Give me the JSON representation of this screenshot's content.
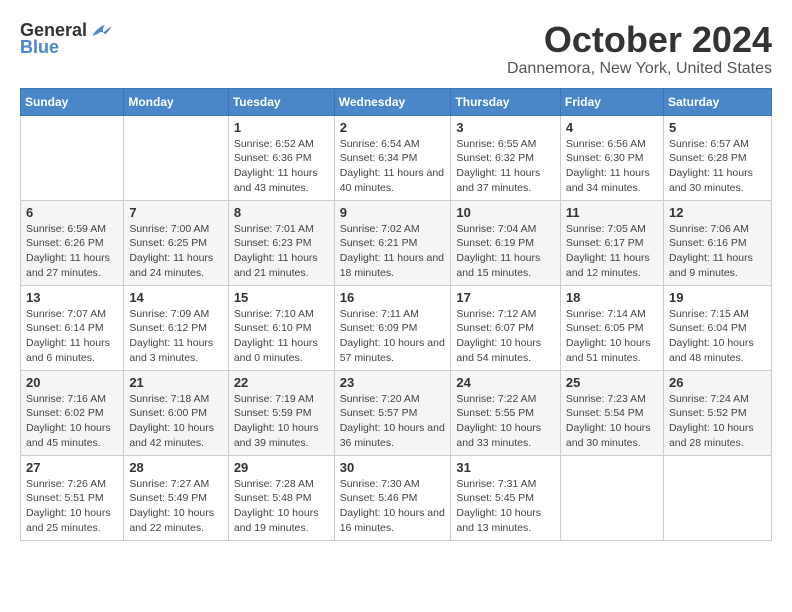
{
  "logo": {
    "general": "General",
    "blue": "Blue"
  },
  "title": "October 2024",
  "location": "Dannemora, New York, United States",
  "days_of_week": [
    "Sunday",
    "Monday",
    "Tuesday",
    "Wednesday",
    "Thursday",
    "Friday",
    "Saturday"
  ],
  "weeks": [
    [
      {
        "day": "",
        "info": ""
      },
      {
        "day": "",
        "info": ""
      },
      {
        "day": "1",
        "info": "Sunrise: 6:52 AM\nSunset: 6:36 PM\nDaylight: 11 hours and 43 minutes."
      },
      {
        "day": "2",
        "info": "Sunrise: 6:54 AM\nSunset: 6:34 PM\nDaylight: 11 hours and 40 minutes."
      },
      {
        "day": "3",
        "info": "Sunrise: 6:55 AM\nSunset: 6:32 PM\nDaylight: 11 hours and 37 minutes."
      },
      {
        "day": "4",
        "info": "Sunrise: 6:56 AM\nSunset: 6:30 PM\nDaylight: 11 hours and 34 minutes."
      },
      {
        "day": "5",
        "info": "Sunrise: 6:57 AM\nSunset: 6:28 PM\nDaylight: 11 hours and 30 minutes."
      }
    ],
    [
      {
        "day": "6",
        "info": "Sunrise: 6:59 AM\nSunset: 6:26 PM\nDaylight: 11 hours and 27 minutes."
      },
      {
        "day": "7",
        "info": "Sunrise: 7:00 AM\nSunset: 6:25 PM\nDaylight: 11 hours and 24 minutes."
      },
      {
        "day": "8",
        "info": "Sunrise: 7:01 AM\nSunset: 6:23 PM\nDaylight: 11 hours and 21 minutes."
      },
      {
        "day": "9",
        "info": "Sunrise: 7:02 AM\nSunset: 6:21 PM\nDaylight: 11 hours and 18 minutes."
      },
      {
        "day": "10",
        "info": "Sunrise: 7:04 AM\nSunset: 6:19 PM\nDaylight: 11 hours and 15 minutes."
      },
      {
        "day": "11",
        "info": "Sunrise: 7:05 AM\nSunset: 6:17 PM\nDaylight: 11 hours and 12 minutes."
      },
      {
        "day": "12",
        "info": "Sunrise: 7:06 AM\nSunset: 6:16 PM\nDaylight: 11 hours and 9 minutes."
      }
    ],
    [
      {
        "day": "13",
        "info": "Sunrise: 7:07 AM\nSunset: 6:14 PM\nDaylight: 11 hours and 6 minutes."
      },
      {
        "day": "14",
        "info": "Sunrise: 7:09 AM\nSunset: 6:12 PM\nDaylight: 11 hours and 3 minutes."
      },
      {
        "day": "15",
        "info": "Sunrise: 7:10 AM\nSunset: 6:10 PM\nDaylight: 11 hours and 0 minutes."
      },
      {
        "day": "16",
        "info": "Sunrise: 7:11 AM\nSunset: 6:09 PM\nDaylight: 10 hours and 57 minutes."
      },
      {
        "day": "17",
        "info": "Sunrise: 7:12 AM\nSunset: 6:07 PM\nDaylight: 10 hours and 54 minutes."
      },
      {
        "day": "18",
        "info": "Sunrise: 7:14 AM\nSunset: 6:05 PM\nDaylight: 10 hours and 51 minutes."
      },
      {
        "day": "19",
        "info": "Sunrise: 7:15 AM\nSunset: 6:04 PM\nDaylight: 10 hours and 48 minutes."
      }
    ],
    [
      {
        "day": "20",
        "info": "Sunrise: 7:16 AM\nSunset: 6:02 PM\nDaylight: 10 hours and 45 minutes."
      },
      {
        "day": "21",
        "info": "Sunrise: 7:18 AM\nSunset: 6:00 PM\nDaylight: 10 hours and 42 minutes."
      },
      {
        "day": "22",
        "info": "Sunrise: 7:19 AM\nSunset: 5:59 PM\nDaylight: 10 hours and 39 minutes."
      },
      {
        "day": "23",
        "info": "Sunrise: 7:20 AM\nSunset: 5:57 PM\nDaylight: 10 hours and 36 minutes."
      },
      {
        "day": "24",
        "info": "Sunrise: 7:22 AM\nSunset: 5:55 PM\nDaylight: 10 hours and 33 minutes."
      },
      {
        "day": "25",
        "info": "Sunrise: 7:23 AM\nSunset: 5:54 PM\nDaylight: 10 hours and 30 minutes."
      },
      {
        "day": "26",
        "info": "Sunrise: 7:24 AM\nSunset: 5:52 PM\nDaylight: 10 hours and 28 minutes."
      }
    ],
    [
      {
        "day": "27",
        "info": "Sunrise: 7:26 AM\nSunset: 5:51 PM\nDaylight: 10 hours and 25 minutes."
      },
      {
        "day": "28",
        "info": "Sunrise: 7:27 AM\nSunset: 5:49 PM\nDaylight: 10 hours and 22 minutes."
      },
      {
        "day": "29",
        "info": "Sunrise: 7:28 AM\nSunset: 5:48 PM\nDaylight: 10 hours and 19 minutes."
      },
      {
        "day": "30",
        "info": "Sunrise: 7:30 AM\nSunset: 5:46 PM\nDaylight: 10 hours and 16 minutes."
      },
      {
        "day": "31",
        "info": "Sunrise: 7:31 AM\nSunset: 5:45 PM\nDaylight: 10 hours and 13 minutes."
      },
      {
        "day": "",
        "info": ""
      },
      {
        "day": "",
        "info": ""
      }
    ]
  ]
}
